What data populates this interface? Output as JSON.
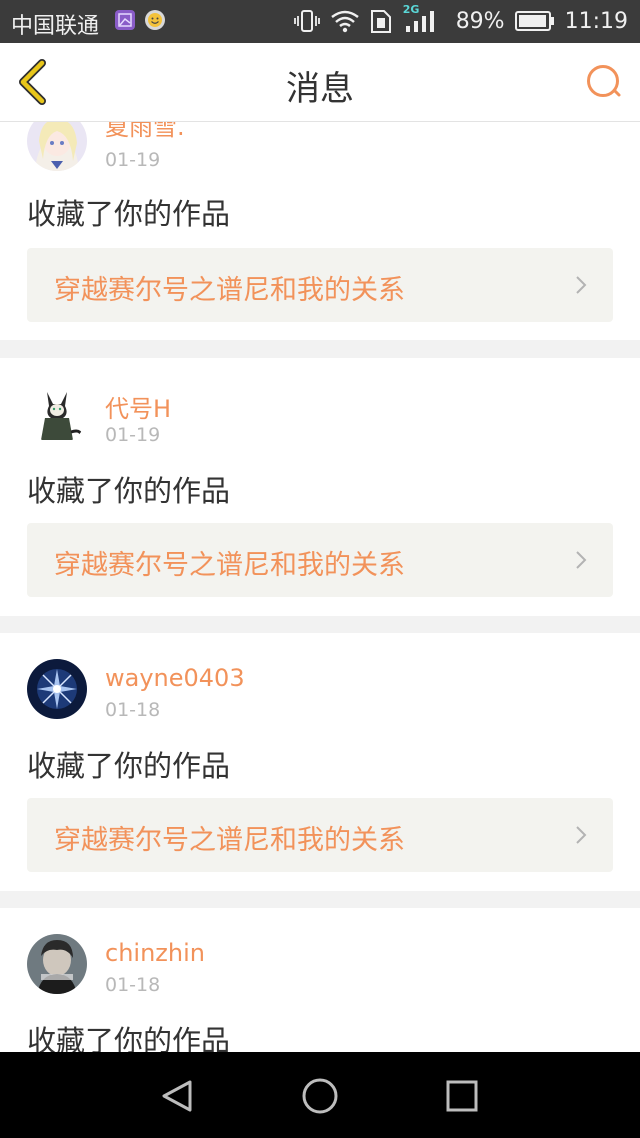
{
  "status_bar": {
    "carrier": "中国联通",
    "network": "2G",
    "battery": "89%",
    "time": "11:19"
  },
  "header": {
    "title": "消息",
    "back_icon": "chevron-left-icon",
    "search_icon": "search-icon"
  },
  "colors": {
    "accent": "#f2925a",
    "back": "#d6b800",
    "link_bg": "#f3f3ef",
    "divider": "#f2f2f2"
  },
  "messages": [
    {
      "username": "夏雨雪.",
      "date": "01-19",
      "action": "收藏了你的作品",
      "work_title": "穿越赛尔号之谱尼和我的关系"
    },
    {
      "username": "代号H",
      "date": "01-19",
      "action": "收藏了你的作品",
      "work_title": "穿越赛尔号之谱尼和我的关系"
    },
    {
      "username": "wayne0403",
      "date": "01-18",
      "action": "收藏了你的作品",
      "work_title": "穿越赛尔号之谱尼和我的关系"
    },
    {
      "username": "chinzhin",
      "date": "01-18",
      "action": "收藏了你的作品"
    }
  ]
}
